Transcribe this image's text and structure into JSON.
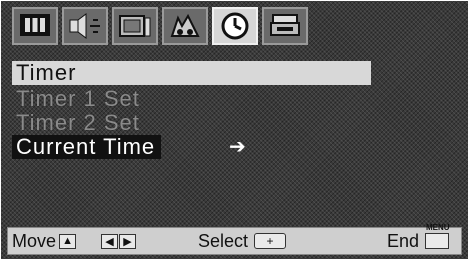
{
  "tabs": [
    {
      "icon": "picture-icon"
    },
    {
      "icon": "sound-icon"
    },
    {
      "icon": "channel-icon"
    },
    {
      "icon": "setup-icon"
    },
    {
      "icon": "clock-icon",
      "active": true
    },
    {
      "icon": "function-icon"
    }
  ],
  "menu": {
    "title": "Timer",
    "items": [
      {
        "label": "Timer 1 Set",
        "enabled": false
      },
      {
        "label": "Timer 2 Set",
        "enabled": false
      },
      {
        "label": "Current Time",
        "selected": true
      }
    ],
    "cursor": "➔"
  },
  "footer": {
    "move_label": "Move",
    "move_key": "▲",
    "lr_keys": [
      "◀",
      "▶"
    ],
    "select_label": "Select",
    "select_key": "+",
    "end_label": "End",
    "end_key": "MENU"
  }
}
